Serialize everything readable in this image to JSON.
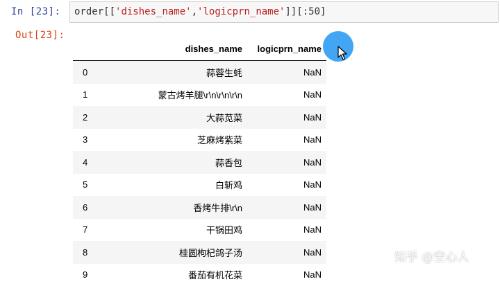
{
  "input_cell": {
    "prompt": "In  [23]:",
    "code_prefix": "order[[",
    "code_str1": "'dishes_name'",
    "code_sep": ",",
    "code_str2": "'logicprn_name'",
    "code_suffix": "]][:50]"
  },
  "output_cell": {
    "prompt": "Out[23]:",
    "columns": [
      "dishes_name",
      "logicprn_name"
    ],
    "rows": [
      {
        "index": "0",
        "dishes_name": "蒜蓉生蚝",
        "logicprn_name": "NaN"
      },
      {
        "index": "1",
        "dishes_name": "蒙古烤羊腿\\r\\n\\r\\n\\r\\n",
        "logicprn_name": "NaN"
      },
      {
        "index": "2",
        "dishes_name": "大蒜苋菜",
        "logicprn_name": "NaN"
      },
      {
        "index": "3",
        "dishes_name": "芝麻烤紫菜",
        "logicprn_name": "NaN"
      },
      {
        "index": "4",
        "dishes_name": "蒜香包",
        "logicprn_name": "NaN"
      },
      {
        "index": "5",
        "dishes_name": "白斩鸡",
        "logicprn_name": "NaN"
      },
      {
        "index": "6",
        "dishes_name": "香烤牛排\\r\\n",
        "logicprn_name": "NaN"
      },
      {
        "index": "7",
        "dishes_name": "干锅田鸡",
        "logicprn_name": "NaN"
      },
      {
        "index": "8",
        "dishes_name": "桂圆枸杞鸽子汤",
        "logicprn_name": "NaN"
      },
      {
        "index": "9",
        "dishes_name": "番茄有机花菜",
        "logicprn_name": "NaN"
      }
    ]
  },
  "watermark": "知乎 @空心人",
  "colors": {
    "in_prompt": "#303f9f",
    "out_prompt": "#d84315",
    "code_string": "#ba2121",
    "cursor_halo": "#2196f3"
  }
}
